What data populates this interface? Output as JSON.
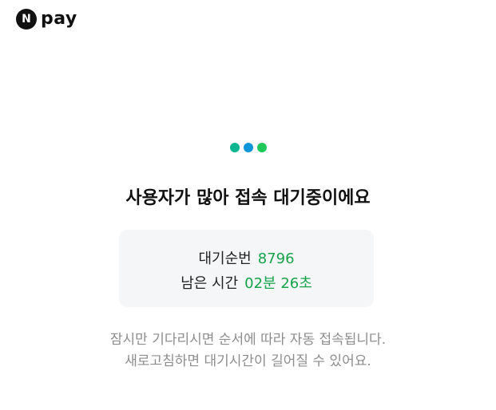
{
  "brand": {
    "badge_letter": "N",
    "name": "pay"
  },
  "loader": {
    "dots": [
      {
        "color": "#0bb592"
      },
      {
        "color": "#0b95d8"
      },
      {
        "color": "#1ec95a"
      }
    ]
  },
  "title": "사용자가 많아 접속 대기중이에요",
  "queue": {
    "position_label": "대기순번",
    "position_value": "8796",
    "remaining_label": "남은 시간",
    "remaining_value": "02분 26초"
  },
  "description": {
    "line1": "잠시만 기다리시면 순서에 따라 자동 접속됩니다.",
    "line2": "새로고침하면 대기시간이 길어질 수 있어요."
  }
}
